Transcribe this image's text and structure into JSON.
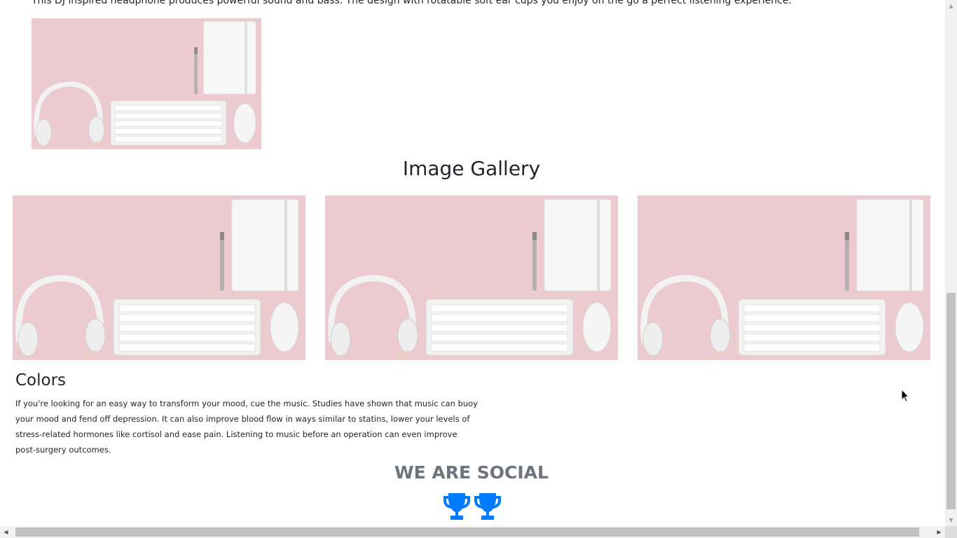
{
  "intro": {
    "text": "This DJ inspired headphone produces powerful sound and bass. The design with rotatable soft ear cups you enjoy on the go a perfect listening experience."
  },
  "gallery": {
    "title": "Image Gallery",
    "images": [
      "photo-1",
      "photo-2",
      "photo-3"
    ]
  },
  "colors": {
    "heading": "Colors",
    "text": "If you're looking for an easy way to transform your mood, cue the music. Studies have shown that music can buoy your mood and fend off depression. It can also improve blood flow in ways similar to statins, lower your levels of stress-related hormones like cortisol and ease pain. Listening to music before an operation can even improve post-surgery outcomes."
  },
  "social": {
    "title": "WE ARE SOCIAL",
    "icons": [
      "trophy-icon",
      "trophy-icon"
    ],
    "icon_color": "#007bff"
  },
  "theme": {
    "photo_background": "#ecc9cf",
    "heading_muted": "#6c757d"
  }
}
